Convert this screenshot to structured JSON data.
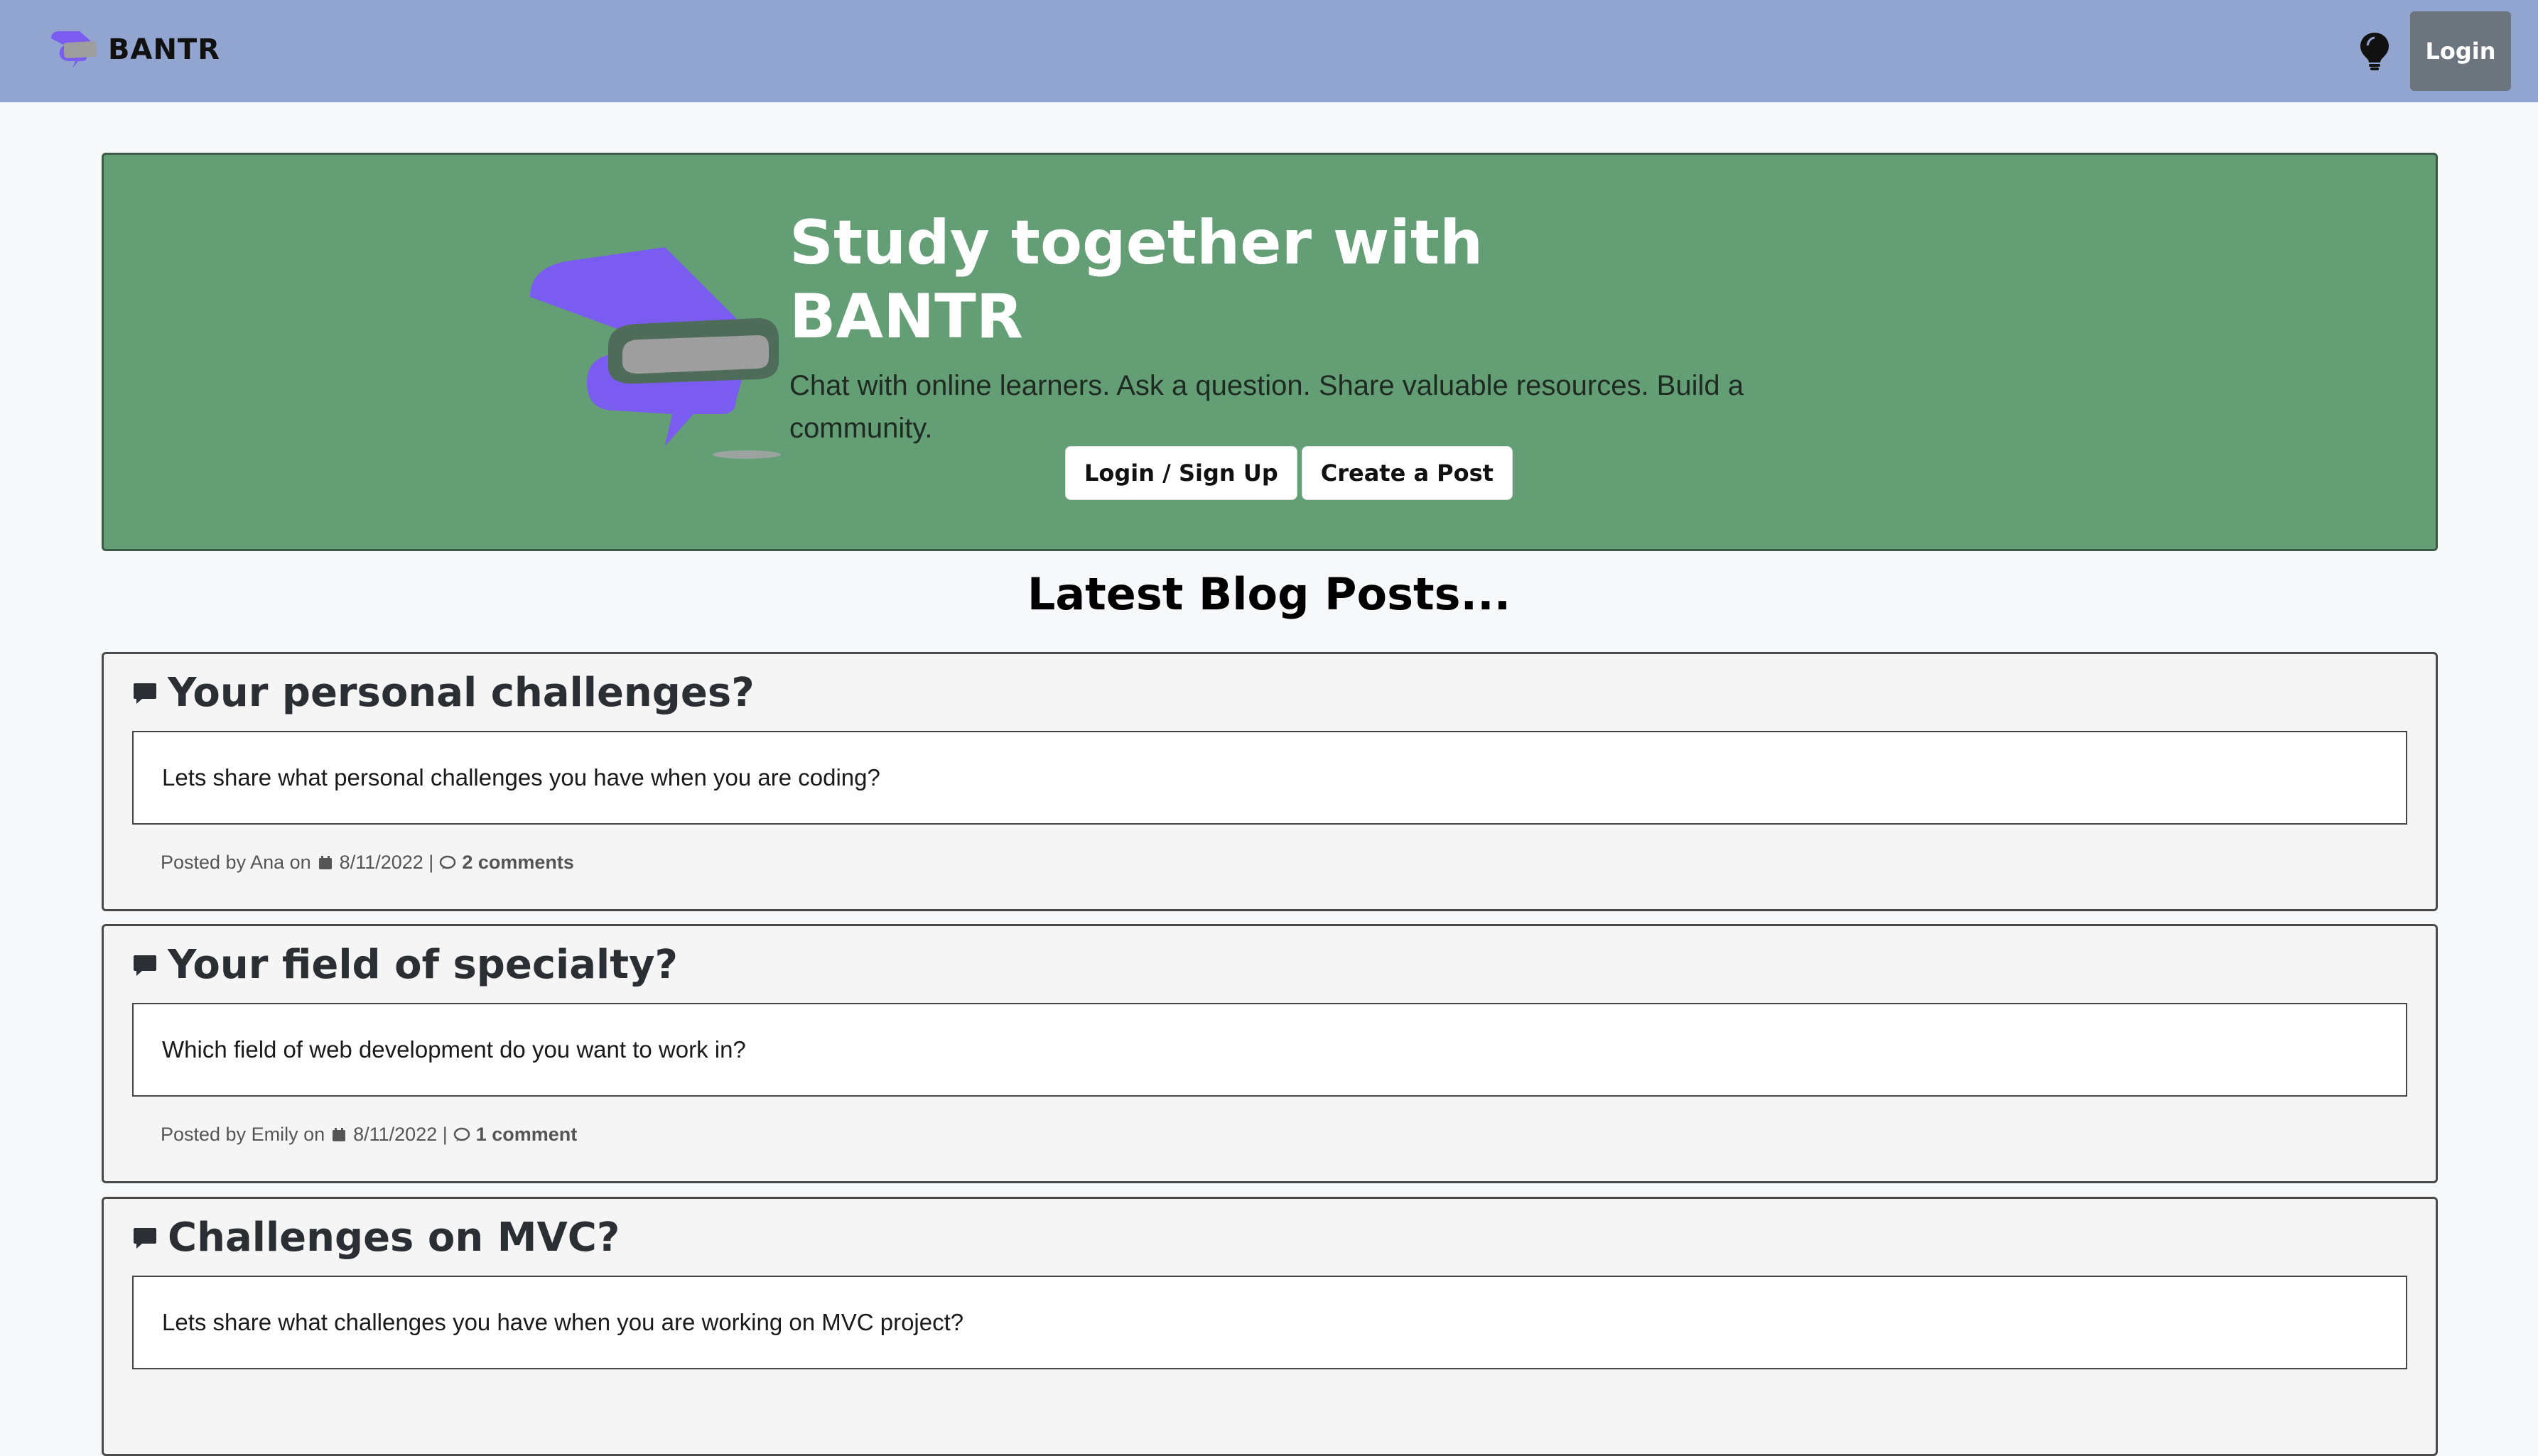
{
  "navbar": {
    "brand": "BANTR",
    "login_label": "Login",
    "theme_icon": "lightbulb-icon"
  },
  "hero": {
    "title": "Study together with BANTR",
    "subtitle": "Chat with online learners. Ask a question. Share valuable resources. Build a community.",
    "login_signup_label": "Login / Sign Up",
    "create_post_label": "Create a Post"
  },
  "section_heading": "Latest Blog Posts...",
  "posts": [
    {
      "title": "Your personal challenges?",
      "body": "Lets share what personal challenges you have when you are coding?",
      "meta_prefix": "Posted by Ana on",
      "date": "8/11/2022 |",
      "comments": "2 comments"
    },
    {
      "title": "Your field of specialty?",
      "body": "Which field of web development do you want to work in?",
      "meta_prefix": "Posted by Emily on",
      "date": "8/11/2022 |",
      "comments": "1 comment"
    },
    {
      "title": "Challenges on MVC?",
      "body": "Lets share what challenges you have when you are working on MVC project?",
      "meta_prefix": "",
      "date": "",
      "comments": ""
    }
  ],
  "colors": {
    "navbar_bg": "#92a5d1",
    "hero_bg": "#639e74",
    "logo_purple": "#7b5cf0",
    "logo_gray": "#9e9e9e"
  }
}
